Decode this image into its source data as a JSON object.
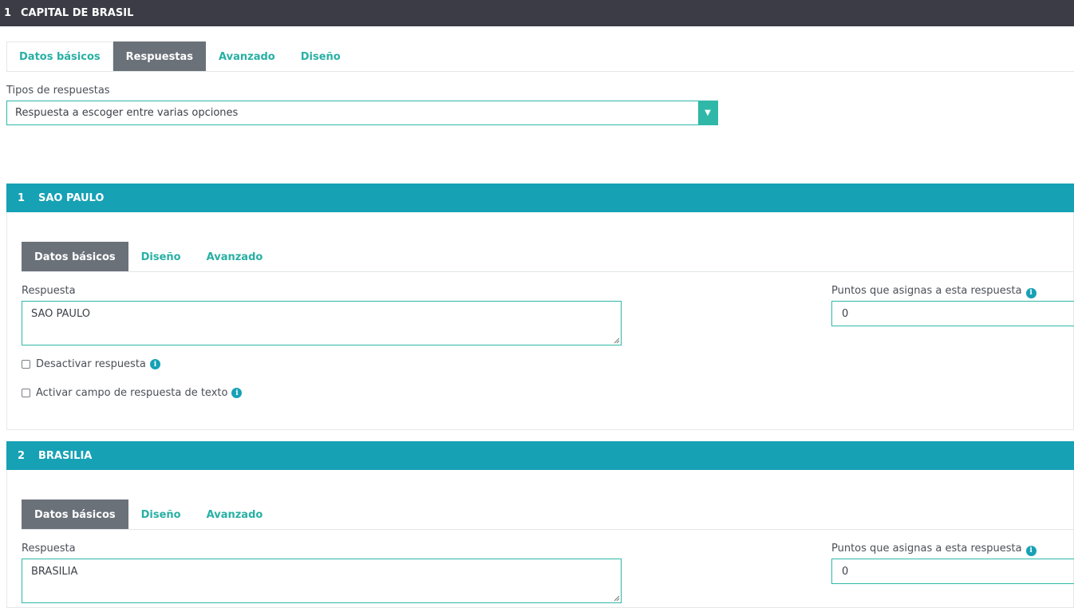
{
  "question": {
    "number": "1",
    "title": "CAPITAL DE BRASIL"
  },
  "question_tabs": [
    {
      "label": "Datos básicos"
    },
    {
      "label": "Respuestas"
    },
    {
      "label": "Avanzado"
    },
    {
      "label": "Diseño"
    }
  ],
  "answer_types": {
    "label": "Tipos de respuestas",
    "selected": "Respuesta a escoger entre varias opciones"
  },
  "answers": [
    {
      "number": "1",
      "title": "SAO PAULO",
      "tabs": [
        "Datos básicos",
        "Diseño",
        "Avanzado"
      ],
      "respuesta_label": "Respuesta",
      "respuesta_value": "SAO PAULO",
      "points_label": "Puntos que asignas a esta respuesta",
      "points_value": "0",
      "disable_label": "Desactivar respuesta",
      "textfield_label": "Activar campo de respuesta de texto"
    },
    {
      "number": "2",
      "title": "BRASILIA",
      "tabs": [
        "Datos básicos",
        "Diseño",
        "Avanzado"
      ],
      "respuesta_label": "Respuesta",
      "respuesta_value": "BRASILIA",
      "points_label": "Puntos que asignas a esta respuesta",
      "points_value": "0"
    }
  ],
  "icons": {
    "info": "info-icon",
    "dropdown": "chevron-down-icon"
  },
  "colors": {
    "accent": "#2fb8a8",
    "section_header": "#17a1b5",
    "top_bar": "#3b3c45",
    "active_tab": "#6b7179"
  }
}
